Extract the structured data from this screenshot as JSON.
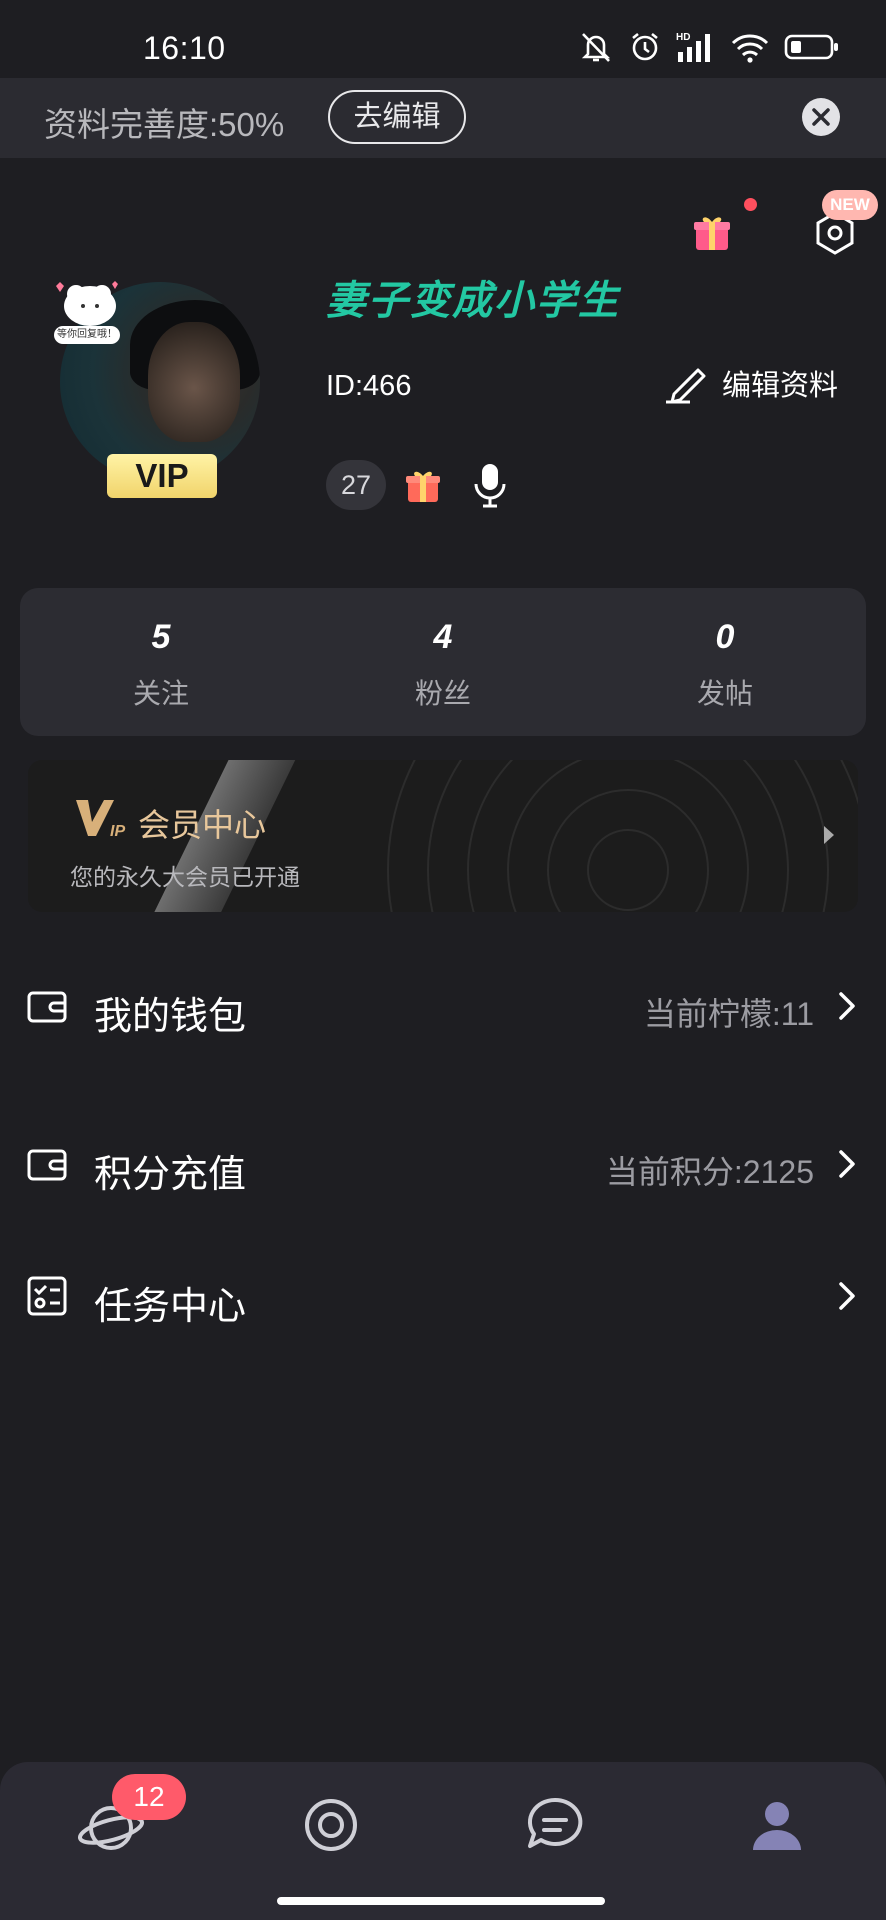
{
  "status_bar": {
    "time": "16:10",
    "icons": [
      "mute-bell-icon",
      "alarm-icon",
      "hd-signal-icon",
      "wifi-icon",
      "battery-icon"
    ]
  },
  "banner": {
    "completion_text": "资料完善度:50%",
    "edit_button_label": "去编辑"
  },
  "profile": {
    "nickname": "妻子变成小学生",
    "id_text": "ID:466",
    "edit_label": "编辑资料",
    "vip_tag": "VIP",
    "level": "27",
    "new_badge": "NEW",
    "sticker_text": "等你回复哦！"
  },
  "stats": [
    {
      "value": "5",
      "label": "关注"
    },
    {
      "value": "4",
      "label": "粉丝"
    },
    {
      "value": "0",
      "label": "发帖"
    }
  ],
  "vip_center": {
    "title": "会员中心",
    "subtitle": "您的永久大会员已开通"
  },
  "menu": [
    {
      "label": "我的钱包",
      "value": "当前柠檬:11",
      "icon": "wallet-icon"
    },
    {
      "label": "积分充值",
      "value": "当前积分:2125",
      "icon": "wallet-icon"
    },
    {
      "label": "任务中心",
      "value": "",
      "icon": "task-checklist-icon"
    }
  ],
  "tabbar": {
    "badge_count": "12",
    "tabs": [
      "planet-icon",
      "discover-icon",
      "message-icon",
      "profile-icon"
    ]
  },
  "colors": {
    "background": "#1e1e22",
    "nickname": "#23c8a3",
    "vip_gold": "#e8c79b",
    "badge_red": "#ff5a6a",
    "active_tab": "#8583b5"
  }
}
